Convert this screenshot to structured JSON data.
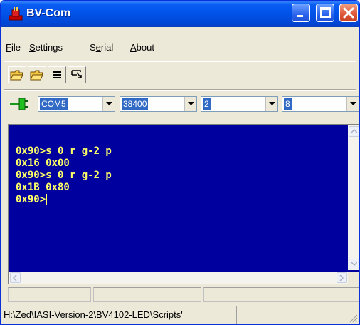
{
  "window": {
    "title": "BV-Com",
    "icon": "plug-red-icon",
    "controls": [
      "minimize-icon",
      "maximize-icon",
      "close-icon"
    ]
  },
  "menu": {
    "file": {
      "u": "F",
      "rest": "ile"
    },
    "settings": {
      "u": "S",
      "rest": "ettings"
    },
    "serial_a": "S",
    "serial_u": "e",
    "serial_b": "rial",
    "about": {
      "u": "A",
      "rest": "bout"
    }
  },
  "toolbar": {
    "buttons": [
      "open-folder-icon",
      "open-folder-2-icon",
      "list-icon",
      "cursor-icon"
    ]
  },
  "port": {
    "connect_icon": "plug-green-icon",
    "port": "COM5",
    "baud": "38400",
    "field3": "2",
    "field4": "8"
  },
  "terminal": {
    "lines": [
      "0x90>s 0 r g-2 p",
      "0x16 0x00",
      "0x90>s 0 r g-2 p",
      "0x1B 0x80",
      "0x90>"
    ],
    "text_color": "#ffff66",
    "bg_color": "#00009f"
  },
  "status": {
    "path": "H:\\Zed\\IASI-Version-2\\BV4102-LED\\Scripts'"
  },
  "colors": {
    "titlebar": "#0052e8",
    "close_button": "#e0593c",
    "selection": "#316ac5"
  }
}
